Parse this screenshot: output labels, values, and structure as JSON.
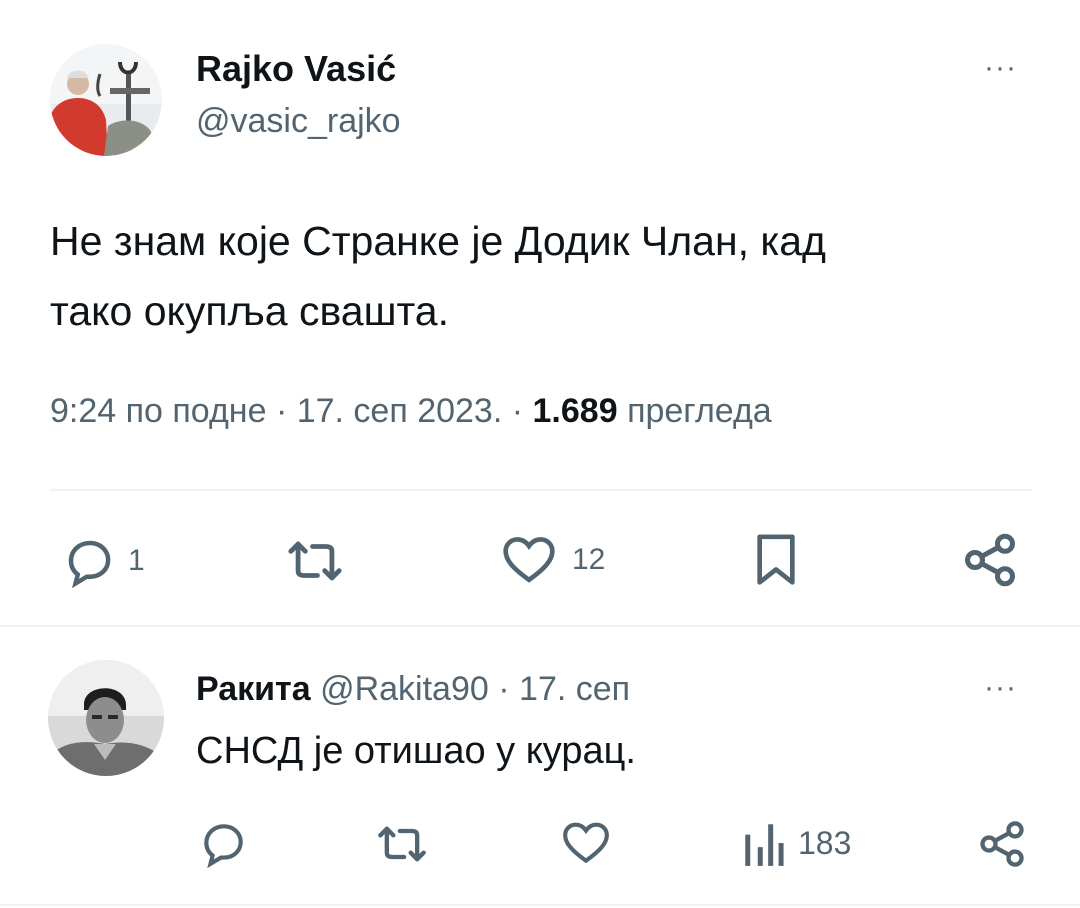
{
  "tweet": {
    "author_name": "Rajko Vasić",
    "author_handle": "@vasic_rajko",
    "text_line1": "Не знам које Странке је Додик Члан, кад",
    "text_line2": "тако окупља свашта.",
    "time": "9:24 по подне",
    "sep": "·",
    "date": "17. сеп 2023.",
    "views_count": "1.689",
    "views_label": "прегледа",
    "replies": "1",
    "likes": "12",
    "more": "···"
  },
  "reply": {
    "author_name": "Ракита",
    "author_handle": "@Rakita90",
    "sep": "·",
    "date": "17. сеп",
    "text": "СНСД је отишао у курац.",
    "views": "183",
    "more": "···"
  },
  "colors": {
    "text": "#0f1419",
    "muted": "#536471",
    "divider": "#eff3f4"
  },
  "icons": [
    "reply-icon",
    "retweet-icon",
    "like-icon",
    "bookmark-icon",
    "share-icon",
    "views-icon",
    "more-icon"
  ]
}
